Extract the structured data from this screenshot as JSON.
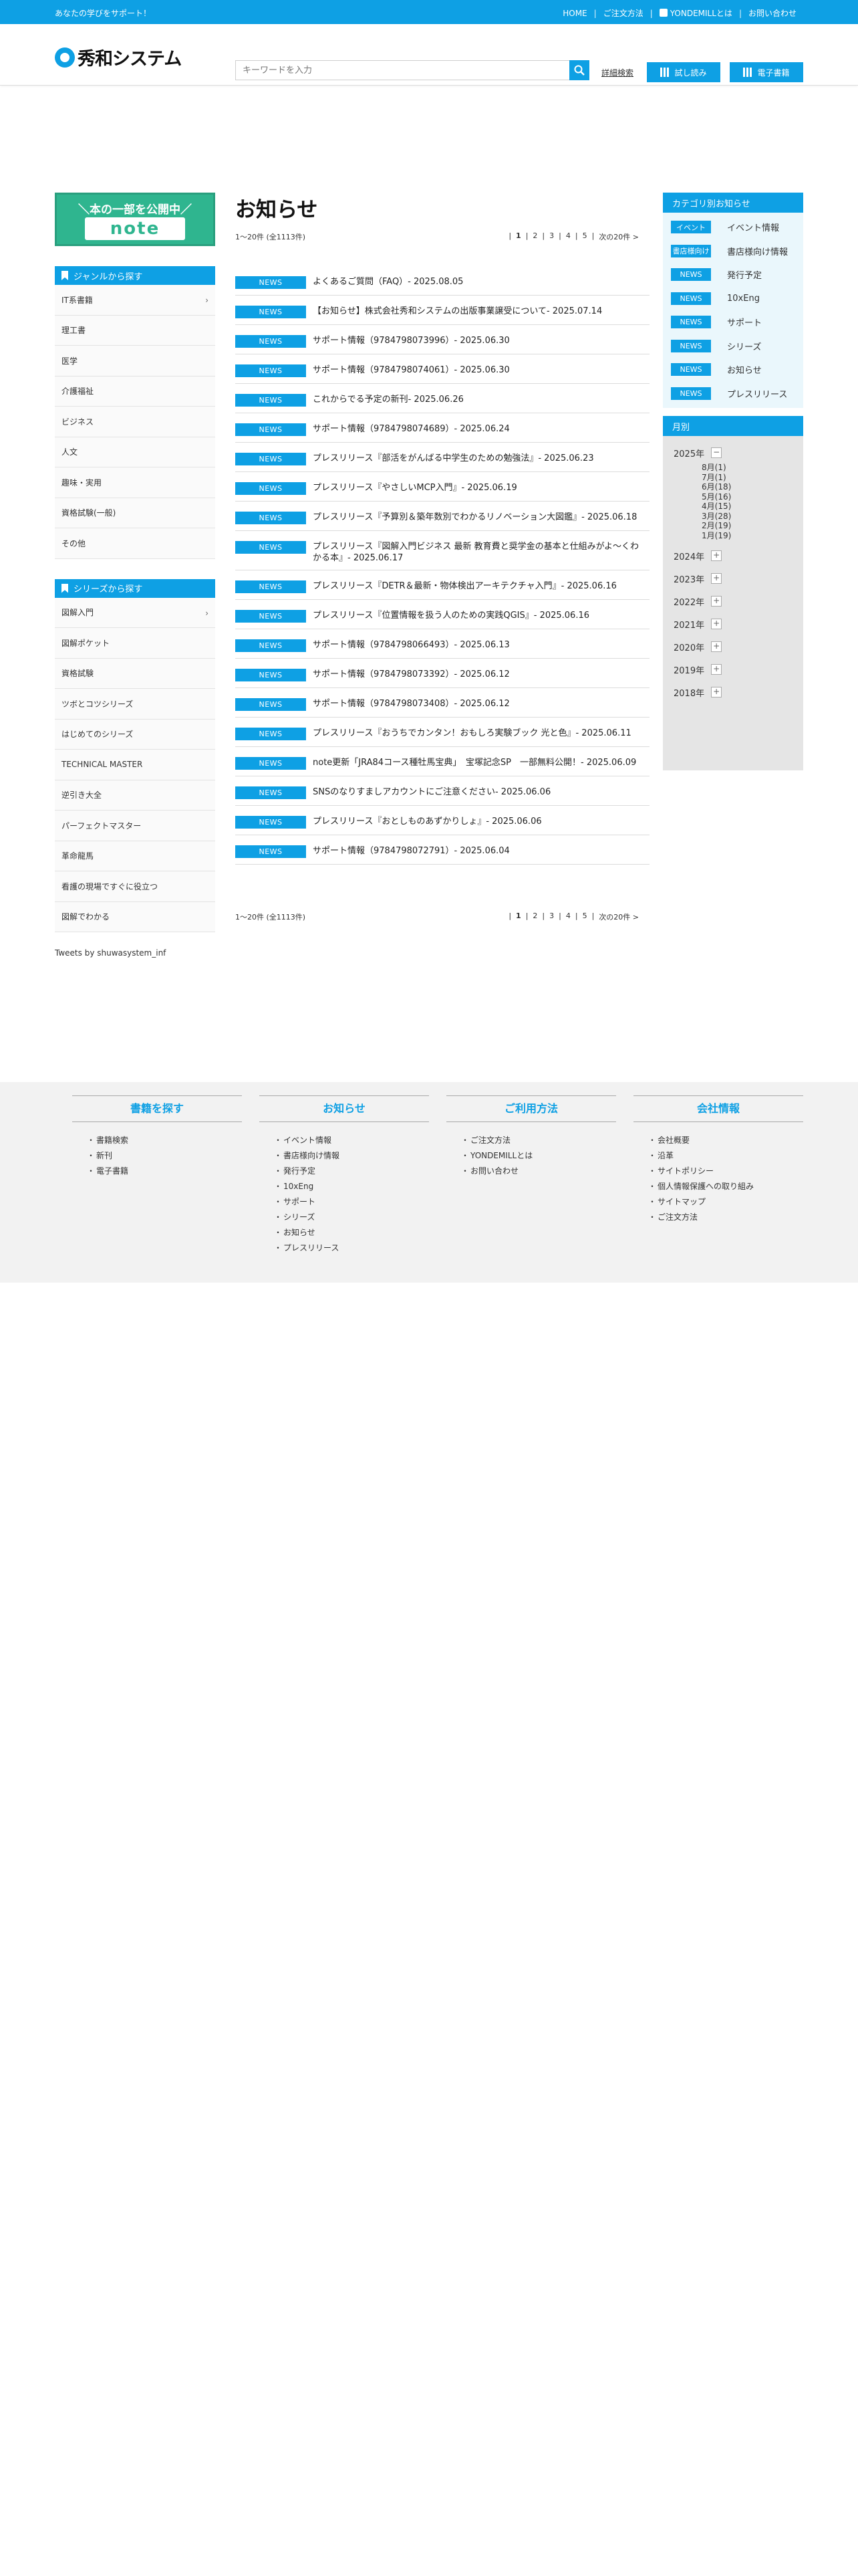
{
  "topbar": {
    "tagline": "あなたの学びをサポート！",
    "links": [
      "HOME",
      "ご注文方法",
      "YONDEMILLとは",
      "お問い合わせ"
    ]
  },
  "header": {
    "logo_text": "秀和システム",
    "search_placeholder": "キーワードを入力",
    "advanced_search": "詳細検索",
    "btn_preview": "試し読み",
    "btn_ebook": "電子書籍"
  },
  "left": {
    "banner_top": "＼本の一部を公開中／",
    "banner_logo": "note",
    "genre_head": "ジャンルから探す",
    "genres": [
      "IT系書籍",
      "理工書",
      "医学",
      "介護福祉",
      "ビジネス",
      "人文",
      "趣味・実用",
      "資格試験(一般)",
      "その他"
    ],
    "series_head": "シリーズから探す",
    "series": [
      "図解入門",
      "図解ポケット",
      "資格試験",
      "ツボとコツシリーズ",
      "はじめてのシリーズ",
      "TECHNICAL MASTER",
      "逆引き大全",
      "パーフェクトマスター",
      "革命龍馬",
      "看護の現場ですぐに役立つ",
      "図解でわかる"
    ],
    "tweets": "Tweets by shuwasystem_inf"
  },
  "main": {
    "title": "お知らせ",
    "count_text": "1〜20件 (全1113件)",
    "pages": [
      "1",
      "2",
      "3",
      "4",
      "5"
    ],
    "next": "次の20件 >",
    "badge": "NEWS",
    "items": [
      "よくあるご質問（FAQ）- 2025.08.05",
      "【お知らせ】株式会社秀和システムの出版事業譲受について- 2025.07.14",
      "サポート情報（9784798073996）- 2025.06.30",
      "サポート情報（9784798074061）- 2025.06.30",
      "これからでる予定の新刊- 2025.06.26",
      "サポート情報（9784798074689）- 2025.06.24",
      "プレスリリース『部活をがんばる中学生のための勉強法』- 2025.06.23",
      "プレスリリース『やさしいMCP入門』- 2025.06.19",
      "プレスリリース『予算別＆築年数別でわかるリノベーション大図鑑』- 2025.06.18",
      "プレスリリース『図解入門ビジネス 最新 教育費と奨学金の基本と仕組みがよ〜くわかる本』- 2025.06.17",
      "プレスリリース『DETR＆最新・物体検出アーキテクチャ入門』- 2025.06.16",
      "プレスリリース『位置情報を扱う人のための実践QGIS』- 2025.06.16",
      "サポート情報（9784798066493）- 2025.06.13",
      "サポート情報（9784798073392）- 2025.06.12",
      "サポート情報（9784798073408）- 2025.06.12",
      "プレスリリース『おうちでカンタン！おもしろ実験ブック 光と色』- 2025.06.11",
      "note更新「JRA84コース種牡馬宝典」　宝塚記念SP　一部無料公開！- 2025.06.09",
      "SNSのなりすましアカウントにご注意ください- 2025.06.06",
      "プレスリリース『おとしものあずかりしょ』- 2025.06.06",
      "サポート情報（9784798072791）- 2025.06.04"
    ]
  },
  "right": {
    "cat_head": "カテゴリ別お知らせ",
    "categories": [
      {
        "badge": "イベント",
        "label": "イベント情報"
      },
      {
        "badge": "書店様向け",
        "label": "書店様向け情報"
      },
      {
        "badge": "NEWS",
        "label": "発行予定"
      },
      {
        "badge": "NEWS",
        "label": "10xEng"
      },
      {
        "badge": "NEWS",
        "label": "サポート"
      },
      {
        "badge": "NEWS",
        "label": "シリーズ"
      },
      {
        "badge": "NEWS",
        "label": "お知らせ"
      },
      {
        "badge": "NEWS",
        "label": "プレスリリース"
      }
    ],
    "month_head": "月別",
    "years": [
      "2025年",
      "2024年",
      "2023年",
      "2022年",
      "2021年",
      "2020年",
      "2019年",
      "2018年"
    ],
    "months_2025": [
      "8月(1)",
      "7月(1)",
      "6月(18)",
      "5月(16)",
      "4月(15)",
      "3月(28)",
      "2月(19)",
      "1月(19)"
    ]
  },
  "footer": {
    "cols": [
      {
        "title": "書籍を探す",
        "items": [
          "書籍検索",
          "新刊",
          "電子書籍"
        ]
      },
      {
        "title": "お知らせ",
        "items": [
          "イベント情報",
          "書店様向け情報",
          "発行予定",
          "10xEng",
          "サポート",
          "シリーズ",
          "お知らせ",
          "プレスリリース"
        ]
      },
      {
        "title": "ご利用方法",
        "items": [
          "ご注文方法",
          "YONDEMILLとは",
          "お問い合わせ"
        ]
      },
      {
        "title": "会社情報",
        "items": [
          "会社概要",
          "沿革",
          "サイトポリシー",
          "個人情報保護への取り組み",
          "サイトマップ",
          "ご注文方法"
        ]
      }
    ]
  },
  "colors": {
    "accent": "#0ea0e4",
    "note_green": "#2fb58f",
    "footer_bg": "#f2f2f2"
  }
}
